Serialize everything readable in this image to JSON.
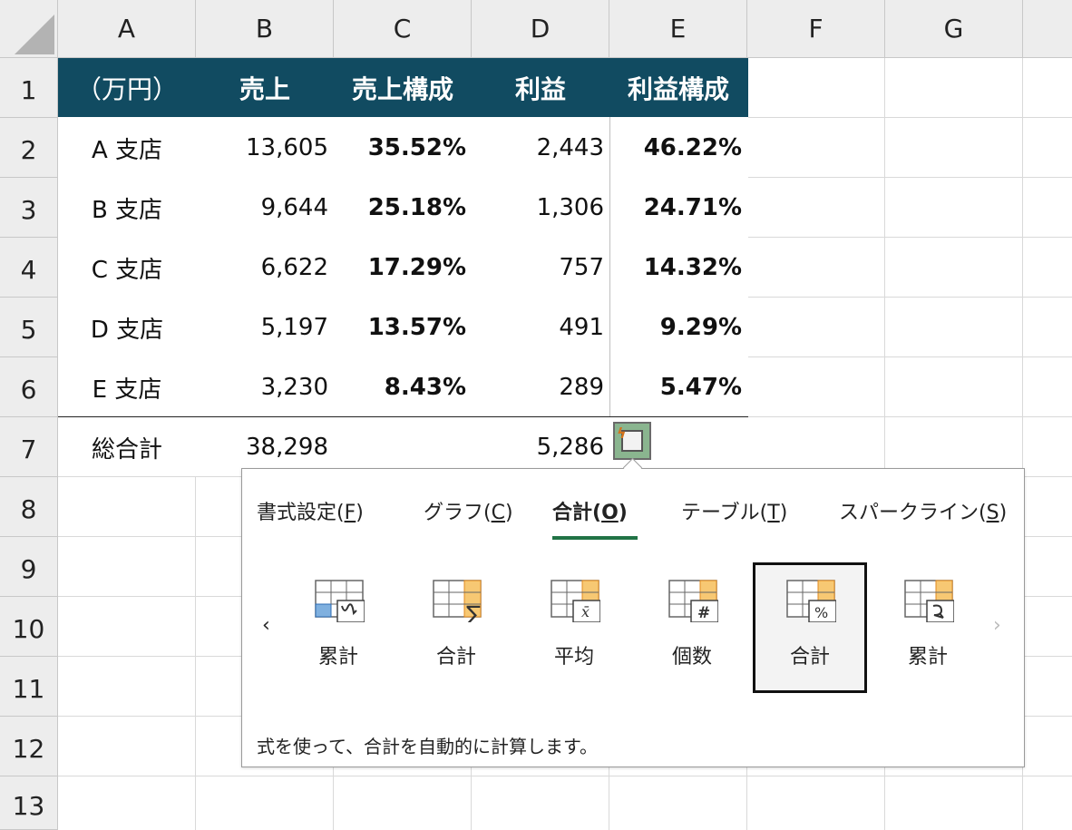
{
  "columns": [
    "A",
    "B",
    "C",
    "D",
    "E",
    "F",
    "G"
  ],
  "rows": [
    "1",
    "2",
    "3",
    "4",
    "5",
    "6",
    "7",
    "8",
    "9",
    "10",
    "11",
    "12",
    "13"
  ],
  "header": {
    "unit": "（万円）",
    "sales": "売上",
    "sales_ratio": "売上構成",
    "profit": "利益",
    "profit_ratio": "利益構成"
  },
  "branches": [
    {
      "name": "A 支店",
      "sales": "13,605",
      "sales_ratio": "35.52%",
      "profit": "2,443",
      "profit_ratio": "46.22%"
    },
    {
      "name": "B 支店",
      "sales": "9,644",
      "sales_ratio": "25.18%",
      "profit": "1,306",
      "profit_ratio": "24.71%"
    },
    {
      "name": "C 支店",
      "sales": "6,622",
      "sales_ratio": "17.29%",
      "profit": "757",
      "profit_ratio": "14.32%"
    },
    {
      "name": "D 支店",
      "sales": "5,197",
      "sales_ratio": "13.57%",
      "profit": "491",
      "profit_ratio": "9.29%"
    },
    {
      "name": "E 支店",
      "sales": "3,230",
      "sales_ratio": "8.43%",
      "profit": "289",
      "profit_ratio": "5.47%"
    }
  ],
  "total": {
    "label": "総合計",
    "sales": "38,298",
    "profit": "5,286"
  },
  "quick_analysis": {
    "tabs": [
      {
        "label": "書式設定(",
        "key": "F",
        "close": ")"
      },
      {
        "label": "グラフ(",
        "key": "C",
        "close": ")"
      },
      {
        "label": "合計(",
        "key": "O",
        "close": ")"
      },
      {
        "label": "テーブル(",
        "key": "T",
        "close": ")"
      },
      {
        "label": "スパークライン(",
        "key": "S",
        "close": ")"
      }
    ],
    "active_tab": "合計(O)",
    "options": [
      {
        "label": "累計",
        "icon": "running-total-row-icon"
      },
      {
        "label": "合計",
        "icon": "sum-icon"
      },
      {
        "label": "平均",
        "icon": "average-icon"
      },
      {
        "label": "個数",
        "icon": "count-icon"
      },
      {
        "label": "合計",
        "icon": "percent-total-icon"
      },
      {
        "label": "累計",
        "icon": "running-total-col-icon"
      }
    ],
    "selected_index": 4,
    "description": "式を使って、合計を自動的に計算します。",
    "nav_prev": "‹",
    "nav_next": "›"
  },
  "colors": {
    "header_bg": "#114b61",
    "accent": "#217346",
    "highlight": "#f7c873",
    "highlight_border": "#e28a1f"
  }
}
